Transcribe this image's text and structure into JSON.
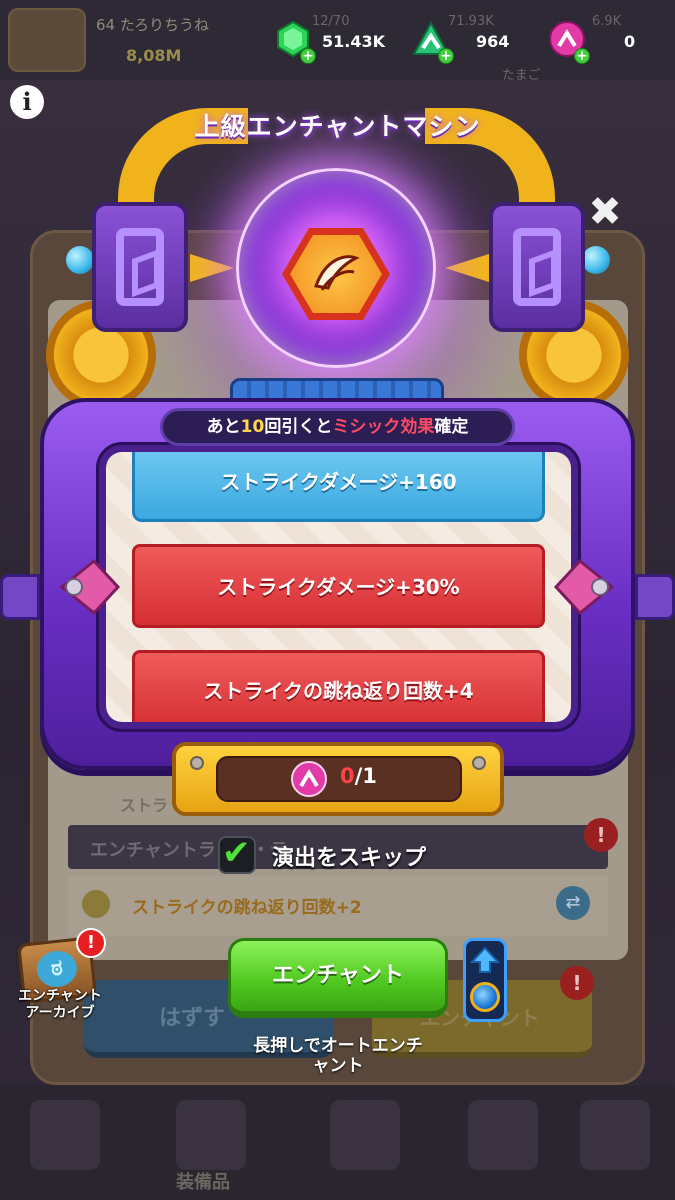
{
  "background": {
    "player_name": "64 たろりちうね",
    "player_power": "8,08M",
    "top_caps": [
      "12/70",
      "71.93K",
      "6.9K",
      "たまご"
    ],
    "section_title": "エンチャントラ・カ・テ",
    "row_text": "ストライクの跳ね返り回数+2",
    "small_row_text": "ストラ",
    "remove_button": "はずす",
    "enchant_button": "エンチャント",
    "nav_label": "装備品"
  },
  "currency": {
    "green_gems": {
      "value": "51.43K",
      "icon": "green-gem-icon"
    },
    "enchant_stones": {
      "value": "964",
      "icon": "green-enchant-stone-icon"
    },
    "mythic_stones": {
      "value": "0",
      "icon": "pink-enchant-stone-icon"
    }
  },
  "machine": {
    "title": "上級エンチャントマシン",
    "banner": {
      "prefix": "あと",
      "count": "10",
      "mid": "回引くと",
      "highlight": "ミシック効果",
      "suffix": "確定"
    },
    "lines": [
      {
        "text": "ストライクダメージ+160",
        "rarity": "rare",
        "color": "#3aa8e0"
      },
      {
        "text": "ストライクダメージ+30%",
        "rarity": "legendary",
        "color": "#d62f34"
      },
      {
        "text": "ストライクの跳ね返り回数+4",
        "rarity": "legendary",
        "color": "#d62f34"
      }
    ],
    "cost": {
      "owned": "0",
      "separator": "/",
      "required": "1"
    }
  },
  "skip": {
    "label": "演出をスキップ",
    "checked": true
  },
  "archive": {
    "label_line1": "エンチャント",
    "label_line2": "アーカイブ",
    "alert": "!"
  },
  "enchant_button": {
    "label": "エンチャント"
  },
  "auto_hint": {
    "line1": "長押しでオートエンチ",
    "line2": "ャント"
  },
  "colors": {
    "accent_purple": "#6a2fc4",
    "gold": "#f1b31c",
    "green_button": "#4ec71f",
    "alert_red": "#e51f22"
  }
}
